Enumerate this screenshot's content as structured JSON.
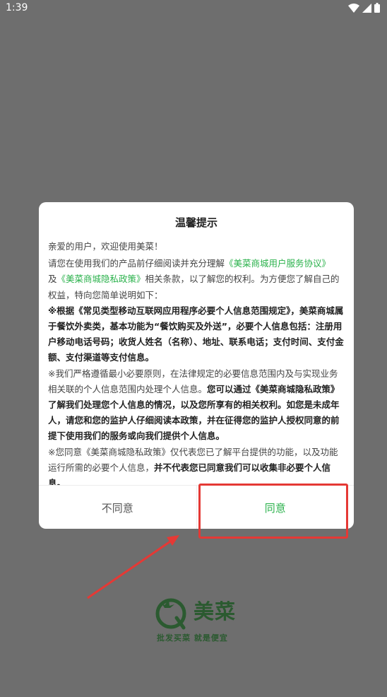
{
  "status_bar": {
    "time": "1:39"
  },
  "dialog": {
    "title": "温馨提示",
    "greeting": "亲爱的用户，欢迎使用美菜！",
    "p1": {
      "t1": "请您在使用我们的产品前仔细阅读并充分理解",
      "link1": "《美菜商城用户服务协议》",
      "t2": "及",
      "link2": "《美菜商城隐私政策》",
      "t3": "相关条款，以了解您的权利。为方便您了解自己的权益，特向您简单说明如下："
    },
    "p2": "※根据《常见类型移动互联网应用程序必要个人信息范围规定》，美菜商城属于餐饮外卖类，基本功能为“餐饮购买及外送”，必要个人信息包括：注册用户移动电话号码；收货人姓名（名称）、地址、联系电话；支付时间、支付金额、支付渠道等支付信息。",
    "p3": {
      "t1": "※我们严格遵循最小必要原则，在法律规定的必要信息范围内及与实现业务相关联的个人信息范围内处理个人信息。",
      "t2": "您可以通过《美菜商城隐私政策》了解我们处理您个人信息的情况，以及您所享有的相关权利。如您是未成年人，请您和您的监护人仔细阅读本政策，并在征得您的监护人授权同意的前提下使用我们的服务或向我们提供个人信息。"
    },
    "p4": {
      "t1": "※您同意《美菜商城隐私政策》仅代表您已了解平台提供的功能，以及功能运行所需的必要个人信息，",
      "t2": "并不代表您已同意我们可以收集非必要个人信息。"
    },
    "disagree_label": "不同意",
    "agree_label": "同意"
  },
  "brand": {
    "name": "美菜",
    "slogan": "批发买菜  就是便宜",
    "color": "#2b5a30"
  },
  "colors": {
    "accent": "#2bb24c",
    "annotation": "#e53935"
  }
}
